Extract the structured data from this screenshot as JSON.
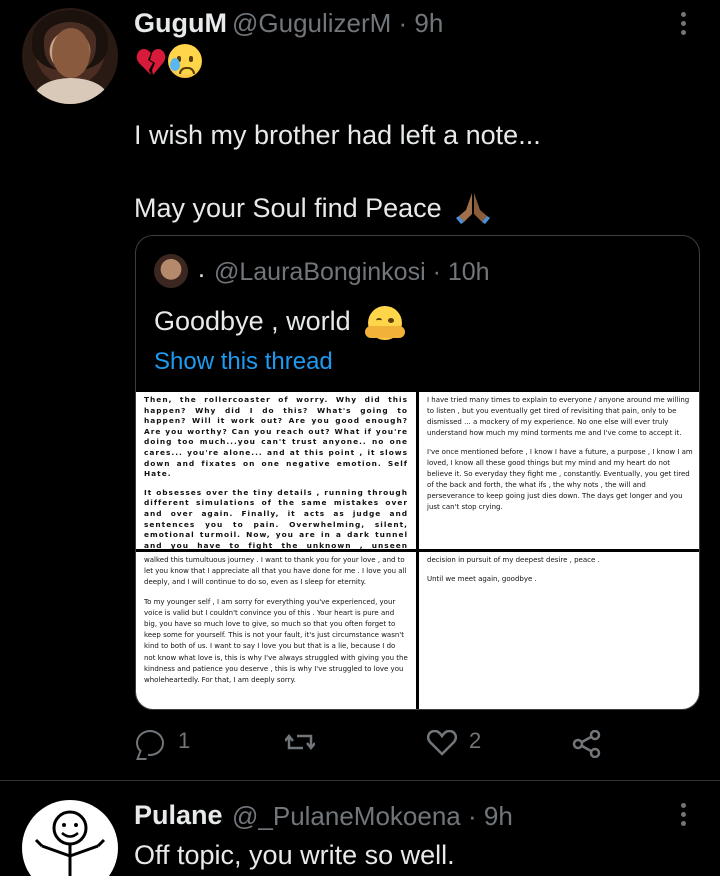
{
  "tweet": {
    "display_name": "GuguM",
    "handle_time": "@GugulizerM · 9h",
    "emoji_line": [
      "broken-heart",
      "sad-relieved-face"
    ],
    "line1": "I wish my brother had left a note...",
    "line2": "May your Soul find Peace",
    "line2_emoji": "folded-hands",
    "quoted": {
      "dot": ".",
      "handle_time": "@LauraBonginkosi · 10h",
      "text": "Goodbye , world",
      "text_emoji": "hugging-face",
      "show_thread": "Show this thread",
      "images": {
        "top_left": [
          "Then, the rollercoaster of worry. Why did this happen? Why did I do this? What's going to happen? Will it work out? Are you good enough? Are you worthy? Can you reach out? What if you're doing too much...you can't trust anyone.. no one cares... you're alone... and at this point , it slows down and fixates on one negative emotion. Self Hate.",
          "It obsesses over the tiny details , running through different simulations of the same mistakes over and over again. Finally, it acts as judge and sentences you to pain. Overwhelming, silent, emotional turmoil. Now, you are in a dark tunnel and you have to fight the unknown , unseen emotions to reach the little opening of light. Peace? Happiness ? Contentment? You never"
        ],
        "top_right": [
          "I have tried many times to explain to everyone / anyone around me willing to listen , but you eventually get tired of revisiting that pain, only to be dismissed ... a mockery of my experience. No one else will ever truly understand how much my mind torments me and I've come to accept it.",
          "I've once mentioned before , I know I have a future, a purpose , I know I am loved, I know all these good things but my mind and my heart do not believe it. So everyday they fight me , constantly. Eventually, you get tired of the back and forth, the what ifs , the why nots , the will and perseverance to keep going just dies down. The days get longer and you just can't stop crying."
        ],
        "bottom_left": [
          "walked this tumultuous journey . I want to thank you for your love , and to let you know that I appreciate all that you have done for me . I love you all deeply, and I will continue to do so, even as I sleep for eternity.",
          "To my younger self , I am sorry for everything you've experienced, your voice is valid but I couldn't convince you of this . Your heart is pure and big, you have so much love to give, so much so that you often forget to keep some for yourself. This is not your fault, it's just circumstance wasn't kind to both of us. I want to say I love you but that is a lie, because I do not know what love is, this is why I've always struggled with giving you the kindness and patience you deserve , this is why I've struggled to love you wholeheartedly. For that, I am deeply sorry."
        ],
        "bottom_right": [
          "decision in pursuit of my deepest desire , peace .",
          "Until we meet again, goodbye ."
        ]
      }
    },
    "actions": {
      "reply_icon": "speech-bubble-icon",
      "reply_count": "1",
      "retweet_icon": "retweet-icon",
      "like_icon": "heart-icon",
      "like_count": "2",
      "share_icon": "share-icon"
    }
  },
  "reply": {
    "display_name": "Pulane",
    "handle_time": "@_PulaneMokoena · 9h",
    "text": "Off topic, you write so well."
  },
  "colors": {
    "background": "#000000",
    "text": "#e7e9ea",
    "muted": "#71767b",
    "link": "#1d9bf0",
    "border": "#3b3f44"
  }
}
